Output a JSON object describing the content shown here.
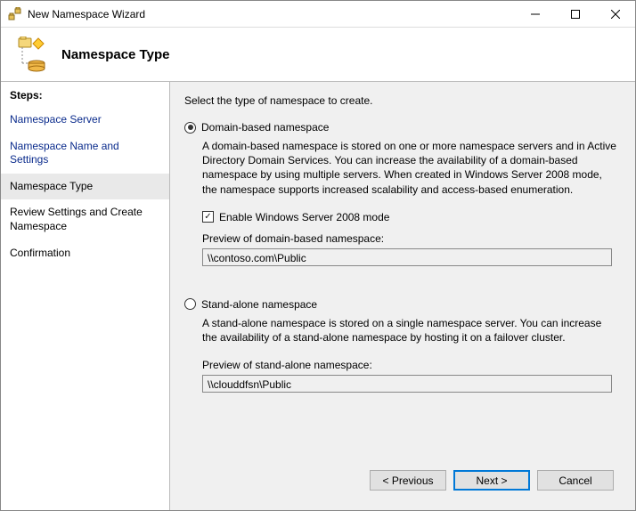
{
  "window": {
    "title": "New Namespace Wizard"
  },
  "header": {
    "title": "Namespace Type"
  },
  "sidebar": {
    "steps_label": "Steps:",
    "items": [
      {
        "label": "Namespace Server"
      },
      {
        "label": "Namespace Name and Settings"
      },
      {
        "label": "Namespace Type"
      },
      {
        "label": "Review Settings and Create Namespace"
      },
      {
        "label": "Confirmation"
      }
    ]
  },
  "content": {
    "instruction": "Select the type of namespace to create.",
    "option1": {
      "label": "Domain-based namespace",
      "desc": "A domain-based namespace is stored on one or more namespace servers and in Active Directory Domain Services. You can increase the availability of a domain-based namespace by using multiple servers. When created in Windows Server 2008 mode, the namespace supports increased scalability and access-based enumeration.",
      "checkbox_label": "Enable Windows Server 2008 mode",
      "preview_label": "Preview of domain-based namespace:",
      "preview_value": "\\\\contoso.com\\Public"
    },
    "option2": {
      "label": "Stand-alone namespace",
      "desc": "A stand-alone namespace is stored on a single namespace server. You can increase the availability of a stand-alone namespace by hosting it on a failover cluster.",
      "preview_label": "Preview of stand-alone namespace:",
      "preview_value": "\\\\clouddfsn\\Public"
    }
  },
  "buttons": {
    "previous": "< Previous",
    "next": "Next >",
    "cancel": "Cancel"
  }
}
